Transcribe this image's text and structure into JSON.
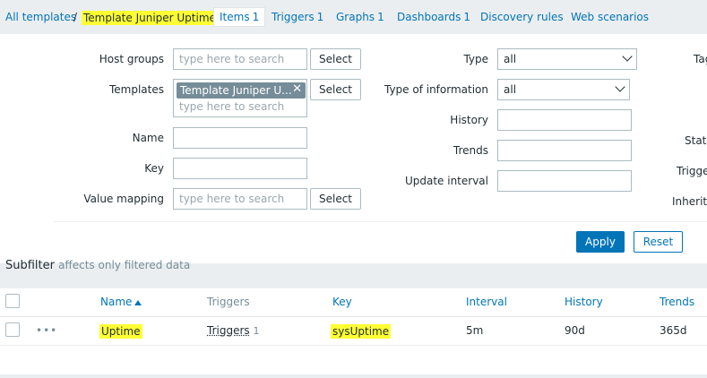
{
  "nav": {
    "breadcrumb_all": "All templates",
    "separator": "/",
    "template_name": "Template Juniper Uptime",
    "tabs": [
      {
        "label": "Items",
        "count": "1"
      },
      {
        "label": "Triggers",
        "count": "1"
      },
      {
        "label": "Graphs",
        "count": "1"
      },
      {
        "label": "Dashboards",
        "count": "1"
      },
      {
        "label": "Discovery rules",
        "count": ""
      },
      {
        "label": "Web scenarios",
        "count": ""
      }
    ],
    "highlight_color": "#ffff33"
  },
  "filter": {
    "host_groups_label": "Host groups",
    "host_groups_placeholder": "type here to search",
    "templates_label": "Templates",
    "templates_chip": "Template Juniper U...",
    "templates_placeholder": "type here to search",
    "name_label": "Name",
    "key_label": "Key",
    "value_mapping_label": "Value mapping",
    "value_mapping_placeholder": "type here to search",
    "select_label": "Select",
    "type_label": "Type",
    "type_value": "all",
    "type_of_info_label": "Type of information",
    "type_of_info_value": "all",
    "history_label": "History",
    "trends_label": "Trends",
    "update_interval_label": "Update interval",
    "right_col_labels": [
      "Tag",
      "Statu",
      "Trigge",
      "Inherite"
    ],
    "apply_label": "Apply",
    "reset_label": "Reset"
  },
  "subfilter": {
    "title": "Subfilter",
    "note": "affects only filtered data"
  },
  "table": {
    "headers": {
      "name": "Name",
      "triggers": "Triggers",
      "key": "Key",
      "interval": "Interval",
      "history": "History",
      "trends": "Trends"
    },
    "rows": [
      {
        "menu": "•••",
        "name": "Uptime",
        "triggers_label": "Triggers",
        "triggers_count": "1",
        "key": "sysUptime",
        "interval": "5m",
        "history": "90d",
        "trends": "365d"
      }
    ]
  },
  "colors": {
    "link": "#0275b8",
    "primary_button": "#0275b8",
    "muted": "#768d99"
  }
}
